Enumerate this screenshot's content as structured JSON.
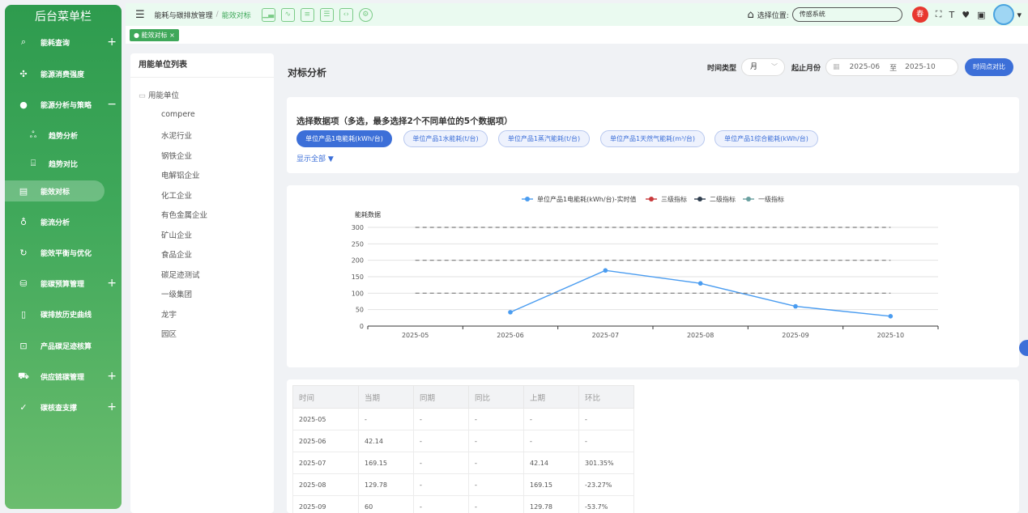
{
  "sidebar": {
    "title": "后台菜单栏",
    "items": [
      {
        "label": "能耗查询",
        "icon": "search-icon",
        "plus": "+"
      },
      {
        "label": "能源消费强度",
        "icon": "crosshair-icon"
      },
      {
        "label": "能源分析与策略",
        "icon": "lightbulb-icon",
        "plus": "−"
      },
      {
        "label": "趋势分析",
        "icon": "trend-icon"
      },
      {
        "label": "趋势对比",
        "icon": "compare-icon"
      },
      {
        "label": "能效对标",
        "icon": "benchmark-icon"
      },
      {
        "label": "能流分析",
        "icon": "flow-icon"
      },
      {
        "label": "能效平衡与优化",
        "icon": "refresh-icon"
      },
      {
        "label": "能碳预算管理",
        "icon": "database-icon",
        "plus": "+"
      },
      {
        "label": "碳排放历史曲线",
        "icon": "book-icon"
      },
      {
        "label": "产品碳足迹核算",
        "icon": "box-icon"
      },
      {
        "label": "供应链碳管理",
        "icon": "truck-icon",
        "plus": "+"
      },
      {
        "label": "碳核查支撑",
        "icon": "check-icon",
        "plus": "+"
      }
    ]
  },
  "topbar": {
    "crumb1": "能耗与碳排放管理",
    "sep": "/",
    "crumb2": "能效对标",
    "location_label": "选择位置:",
    "location_value": "传感系统",
    "badge": "春"
  },
  "tag": {
    "label": "● 能效对标 ×"
  },
  "list_panel": {
    "title": "用能单位列表",
    "root": "用能单位",
    "items": [
      "compere",
      "水泥行业",
      "钢铁企业",
      "电解铝企业",
      "化工企业",
      "有色金属企业",
      "矿山企业",
      "食品企业",
      "碳足迹测试",
      "一级集团",
      "龙宇",
      "园区"
    ]
  },
  "main": {
    "title": "对标分析",
    "time_type_label": "时间类型",
    "time_type_value": "月",
    "range_label": "起止月份",
    "start": "2025-06",
    "to": "至",
    "end": "2025-10",
    "compare_button": "时间点对比"
  },
  "selector": {
    "title": "选择数据项（多选，最多选择2个不同单位的5个数据项）",
    "pills": [
      "单位产品1电能耗(kWh/台)",
      "单位产品1水能耗(t/台)",
      "单位产品1蒸汽能耗(t/台)",
      "单位产品1天然气能耗(m³/台)",
      "单位产品1综合能耗(kWh/台)"
    ],
    "show_all": "显示全部 ▼"
  },
  "chart_data": {
    "type": "line",
    "ylabel": "能耗数据",
    "categories": [
      "2025-05",
      "2025-06",
      "2025-07",
      "2025-08",
      "2025-09",
      "2025-10"
    ],
    "ylim": [
      0,
      300
    ],
    "yticks": [
      0,
      50,
      100,
      150,
      200,
      250,
      300
    ],
    "legend_position": "top",
    "series": [
      {
        "name": "单位产品1电能耗(kWh/台)-实时值",
        "color": "#4a9cf0",
        "values": [
          null,
          42.14,
          169.15,
          129.78,
          60,
          30
        ]
      },
      {
        "name": "三级指标",
        "color": "#c8393b",
        "values": [
          100,
          100,
          100,
          100,
          100,
          100
        ]
      },
      {
        "name": "二级指标",
        "color": "#2f3e4e",
        "values": [
          200,
          200,
          200,
          200,
          200,
          200
        ]
      },
      {
        "name": "一级指标",
        "color": "#6aa0a0",
        "values": [
          300,
          300,
          300,
          300,
          300,
          300
        ]
      }
    ]
  },
  "table": {
    "headers": [
      "时间",
      "当期",
      "同期",
      "同比",
      "上期",
      "环比"
    ],
    "rows": [
      [
        "2025-05",
        "-",
        "-",
        "-",
        "-",
        "-"
      ],
      [
        "2025-06",
        "42.14",
        "-",
        "-",
        "-",
        "-"
      ],
      [
        "2025-07",
        "169.15",
        "-",
        "-",
        "42.14",
        "301.35%"
      ],
      [
        "2025-08",
        "129.78",
        "-",
        "-",
        "169.15",
        "-23.27%"
      ],
      [
        "2025-09",
        "60",
        "-",
        "-",
        "129.78",
        "-53.7%"
      ]
    ]
  }
}
